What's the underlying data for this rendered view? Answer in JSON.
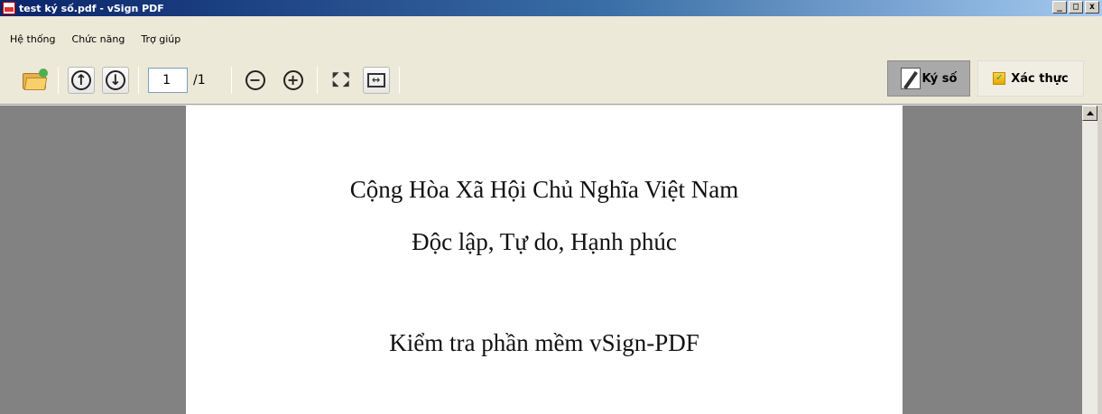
{
  "window": {
    "title": "test ký số.pdf - vSign PDF",
    "controls": {
      "minimize": "_",
      "maximize": "□",
      "close": "x"
    }
  },
  "menu": {
    "items": [
      {
        "label": "Hệ thống"
      },
      {
        "label": "Chức năng"
      },
      {
        "label": "Trợ giúp"
      }
    ]
  },
  "toolbar": {
    "current_page": "1",
    "total_pages": "/1",
    "sign_label": "Ký số",
    "verify_label": "Xác thực",
    "icons": [
      "open-folder-icon",
      "page-up-icon",
      "page-down-icon",
      "zoom-out-icon",
      "zoom-in-icon",
      "fit-page-icon",
      "fit-width-icon",
      "sign-icon",
      "verify-icon"
    ]
  },
  "document": {
    "lines": [
      "Cộng Hòa Xã Hội Chủ Nghĩa Việt Nam",
      "Độc lập, Tự do, Hạnh phúc",
      "Kiểm tra phần mềm vSign-PDF"
    ]
  },
  "colors": {
    "viewer_background": "#828282",
    "page_background": "#ffffff",
    "sign_button_active": "#a9a9a9"
  }
}
